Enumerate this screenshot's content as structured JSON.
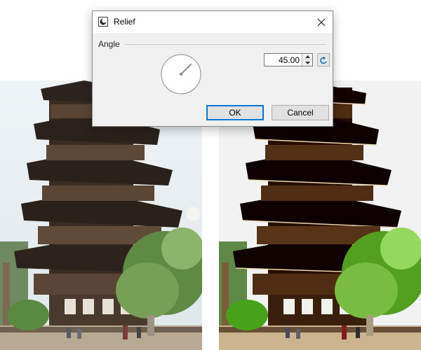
{
  "dialog": {
    "title": "Relief",
    "icon": "app-icon",
    "close_icon": "close-icon"
  },
  "angle": {
    "group_label": "Angle",
    "value": "45.00",
    "value_number": 45,
    "reset_icon": "reset-icon"
  },
  "buttons": {
    "ok": "OK",
    "cancel": "Cancel"
  },
  "colors": {
    "focus_blue": "#0078d7",
    "reset_icon_blue": "#1f6fc5",
    "dialog_bg": "#f0f0f0"
  }
}
